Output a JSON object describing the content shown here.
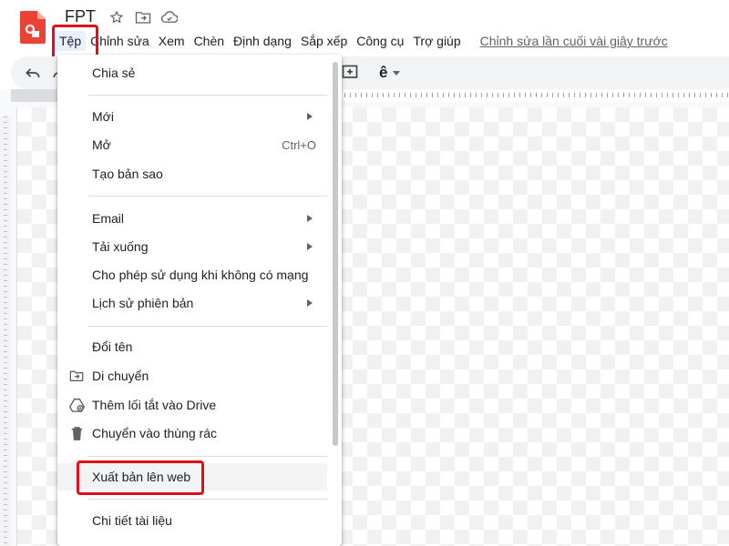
{
  "doc": {
    "title": "FPT"
  },
  "menubar": {
    "items": [
      {
        "label": "Tệp"
      },
      {
        "label": "Chỉnh sửa"
      },
      {
        "label": "Xem"
      },
      {
        "label": "Chèn"
      },
      {
        "label": "Định dạng"
      },
      {
        "label": "Sắp xếp"
      },
      {
        "label": "Công cụ"
      },
      {
        "label": "Trợ giúp"
      }
    ],
    "last_edit": "Chỉnh sửa lần cuối vài giây trước"
  },
  "file_menu": {
    "items": [
      {
        "label": "Chia sẻ"
      },
      {
        "label": "Mới"
      },
      {
        "label": "Mở",
        "shortcut": "Ctrl+O"
      },
      {
        "label": "Tạo bản sao"
      },
      {
        "label": "Email"
      },
      {
        "label": "Tải xuống"
      },
      {
        "label": "Cho phép sử dụng khi không có mạng"
      },
      {
        "label": "Lịch sử phiên bản"
      },
      {
        "label": "Đổi tên"
      },
      {
        "label": "Di chuyển"
      },
      {
        "label": "Thêm lối tắt vào Drive"
      },
      {
        "label": "Chuyển vào thùng rác"
      },
      {
        "label": "Xuất bản lên web"
      },
      {
        "label": "Chi tiết tài liệu"
      }
    ]
  },
  "colors": {
    "highlight_border": "#e0101b",
    "app_logo": "#ea4335",
    "hover_bg": "#f1f3f4"
  },
  "icons": {
    "app": "drawings-logo-icon",
    "star": "star-icon",
    "move_title": "folder-move-icon",
    "cloud": "cloud-saved-icon",
    "undo": "undo-icon",
    "redo": "redo-icon",
    "comment": "add-comment-icon",
    "format": "text-format-icon",
    "move": "folder-move-icon",
    "shortcut": "drive-shortcut-icon",
    "trash": "trash-icon"
  }
}
